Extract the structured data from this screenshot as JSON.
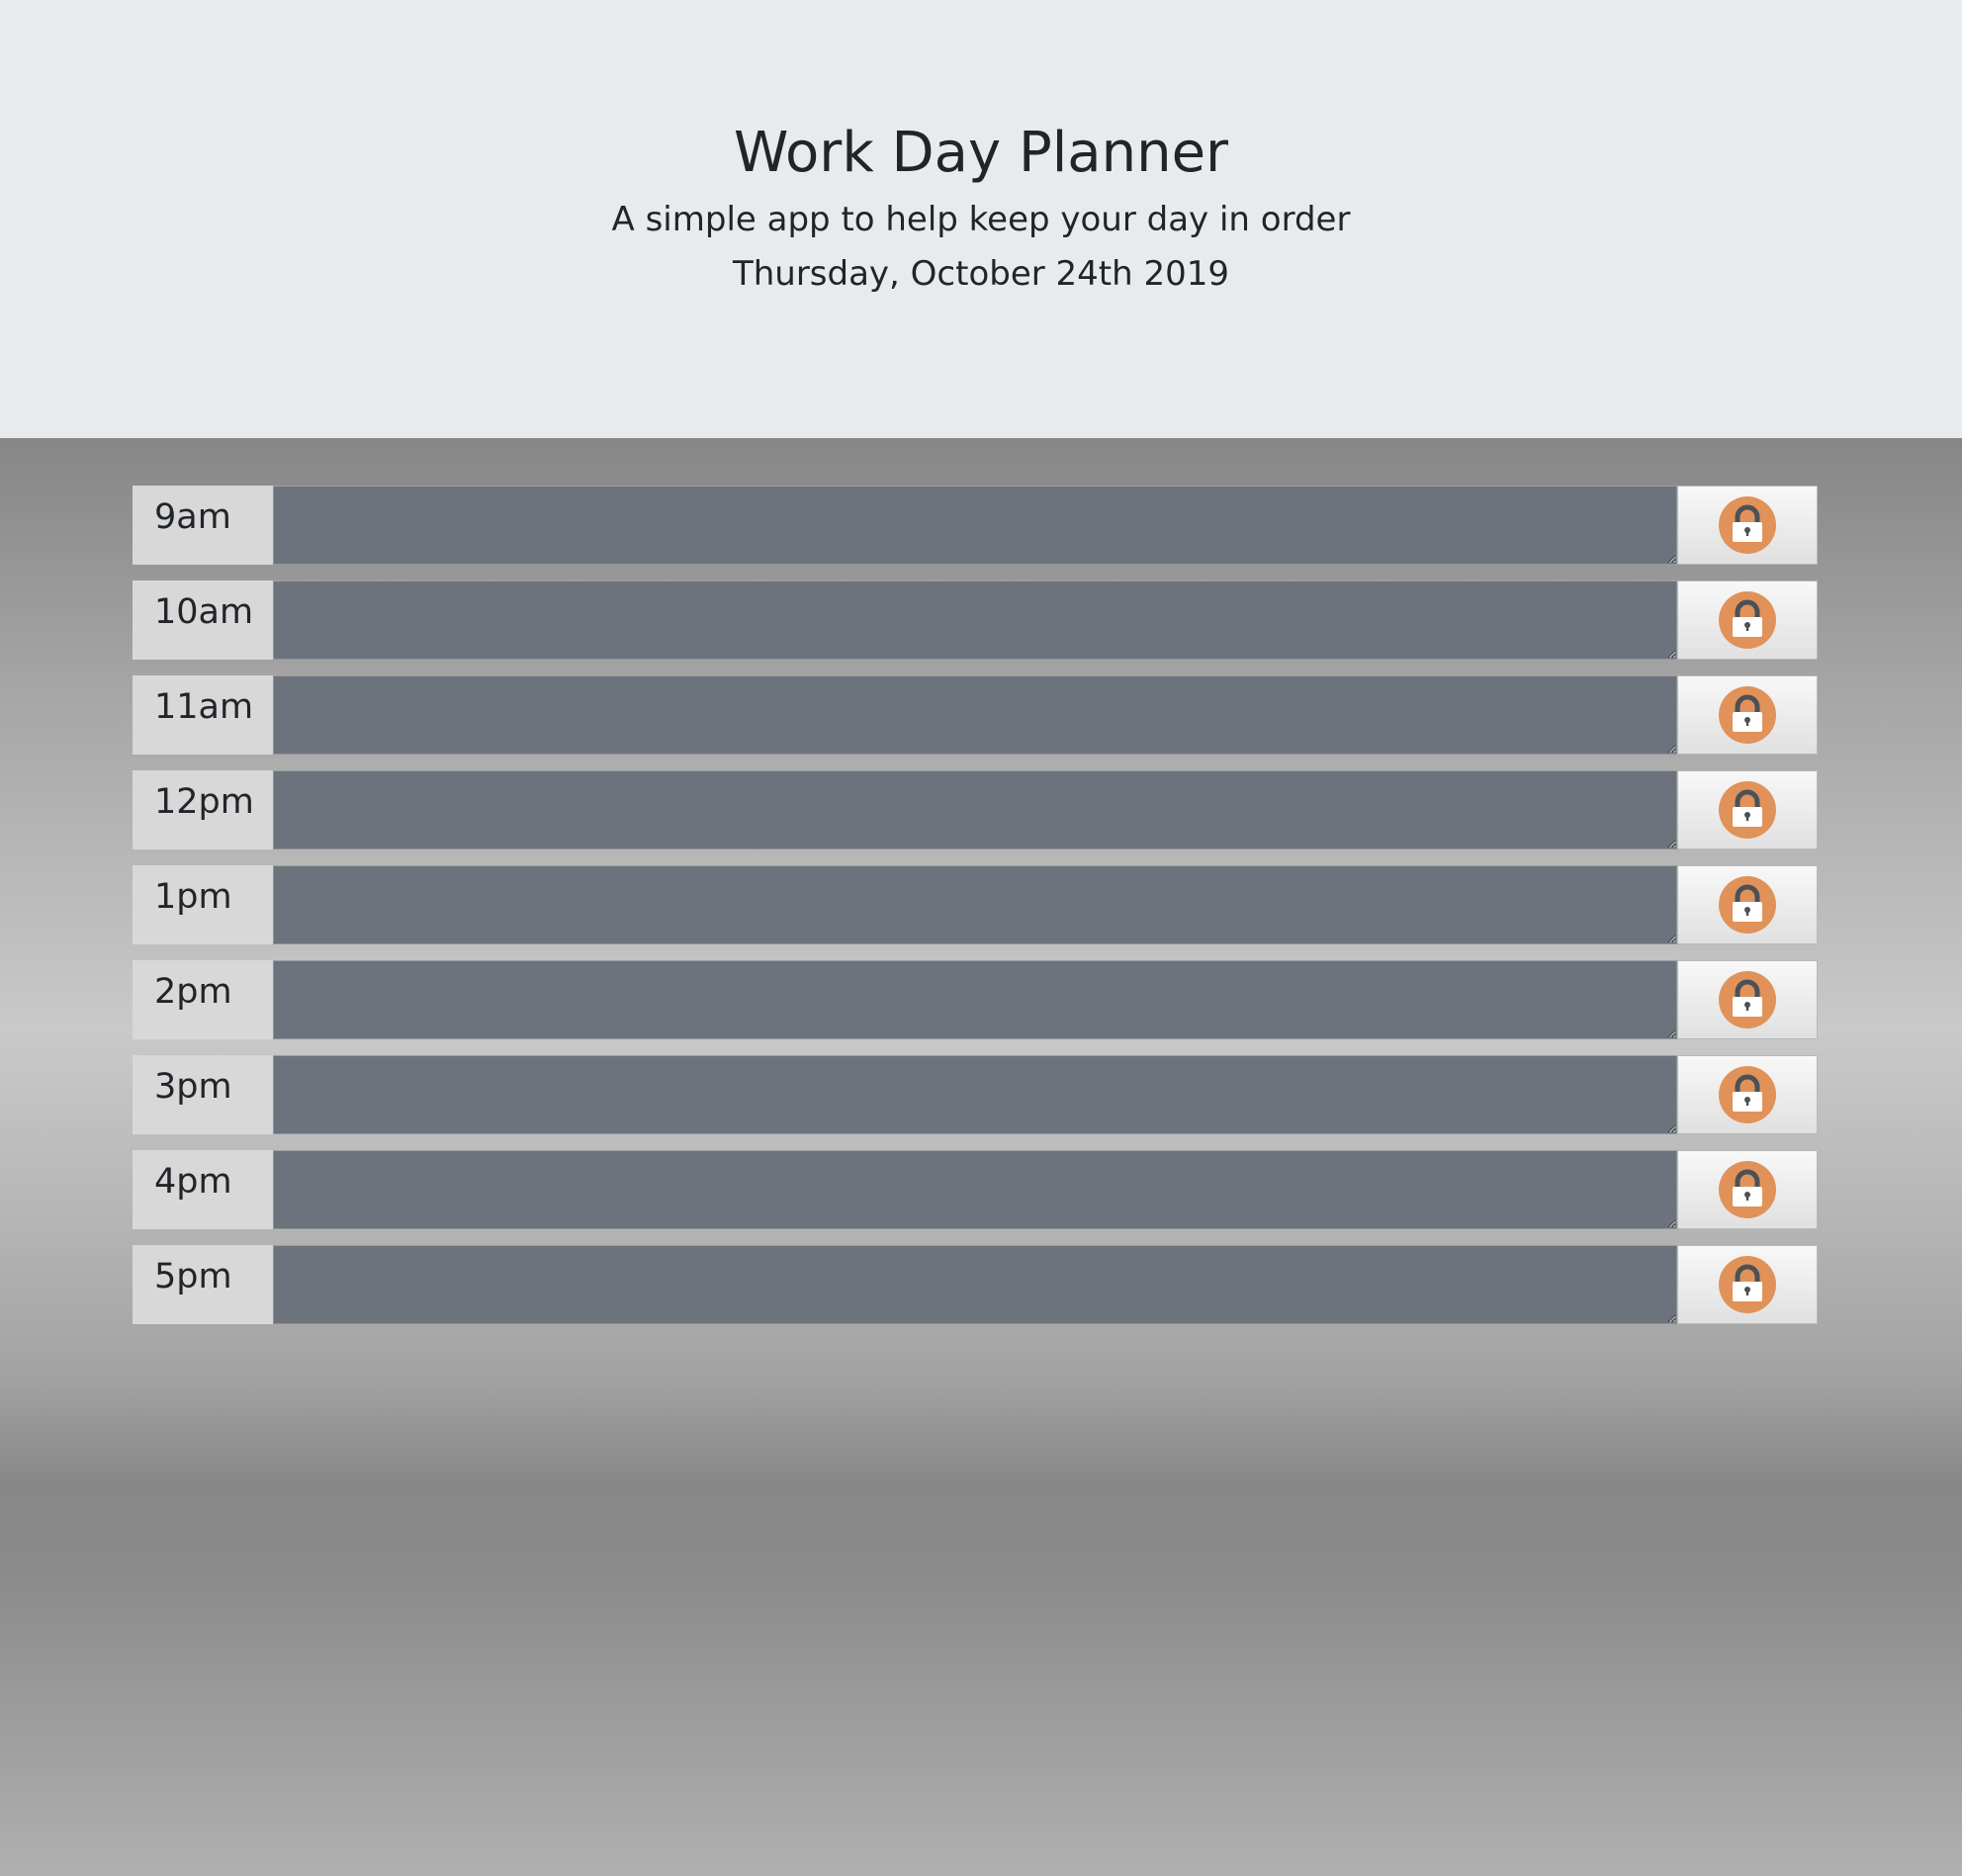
{
  "header": {
    "title": "Work Day Planner",
    "subtitle": "A simple app to help keep your day in order",
    "current_date": "Thursday, October 24th 2019"
  },
  "planner": {
    "rows": [
      {
        "hour": "9am",
        "text": ""
      },
      {
        "hour": "10am",
        "text": ""
      },
      {
        "hour": "11am",
        "text": ""
      },
      {
        "hour": "12pm",
        "text": ""
      },
      {
        "hour": "1pm",
        "text": ""
      },
      {
        "hour": "2pm",
        "text": ""
      },
      {
        "hour": "3pm",
        "text": ""
      },
      {
        "hour": "4pm",
        "text": ""
      },
      {
        "hour": "5pm",
        "text": ""
      }
    ],
    "save_icon": "lock-icon"
  },
  "colors": {
    "header_bg": "#e8ebee",
    "hour_bg": "#d8d8d8",
    "textarea_bg": "#6c737d",
    "lock_accent": "#e19259",
    "text": "#212529"
  }
}
